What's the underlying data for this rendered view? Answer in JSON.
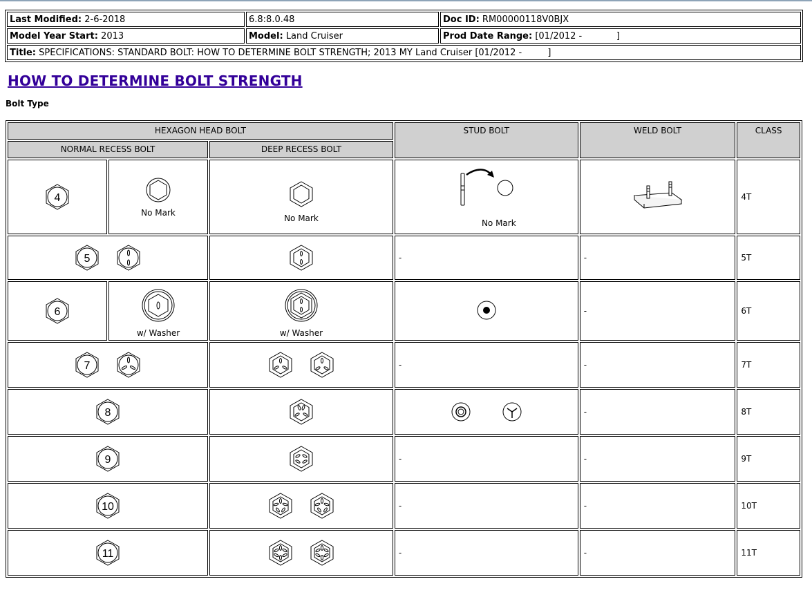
{
  "header": {
    "last_modified_label": "Last Modified:",
    "last_modified_value": "2-6-2018",
    "version": "6.8:8.0.48",
    "doc_id_label": "Doc ID:",
    "doc_id_value": "RM00000118V0BJX",
    "model_year_label": "Model Year Start:",
    "model_year_value": "2013",
    "model_label": "Model:",
    "model_value": "Land Cruiser",
    "prod_date_label": "Prod Date Range:",
    "prod_date_value": "[01/2012 -            ]",
    "title_label": "Title:",
    "title_value": "SPECIFICATIONS: STANDARD BOLT: HOW TO DETERMINE BOLT STRENGTH; 2013 MY Land Cruiser [01/2012 -         ]"
  },
  "page_title": "HOW TO DETERMINE BOLT STRENGTH",
  "subtitle": "Bolt Type",
  "table": {
    "headers": {
      "hexagon": "HEXAGON HEAD BOLT",
      "stud": "STUD BOLT",
      "weld": "WELD BOLT",
      "class": "CLASS",
      "normal": "NORMAL RECESS BOLT",
      "deep": "DEEP RECESS BOLT"
    },
    "captions": {
      "no_mark": "No Mark",
      "washer": "w/ Washer"
    },
    "dash": "-",
    "num4": "4",
    "num5": "5",
    "num6": "6",
    "num7": "7",
    "num8": "8",
    "num9": "9",
    "num10": "10",
    "num11": "11",
    "classes": [
      "4T",
      "5T",
      "6T",
      "7T",
      "8T",
      "9T",
      "10T",
      "11T"
    ]
  }
}
